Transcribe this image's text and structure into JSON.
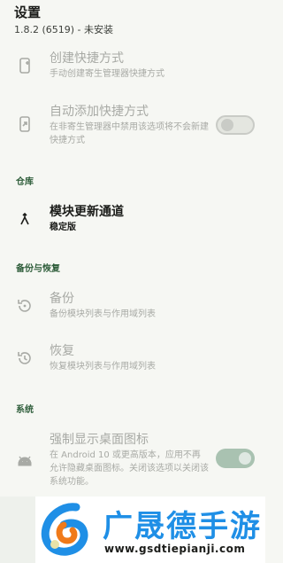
{
  "header": {
    "title": "设置",
    "subtitle": "1.8.2 (6519) - 未安装"
  },
  "shortcuts": {
    "create": {
      "title": "创建快捷方式",
      "summary": "手动创建寄生管理器快捷方式"
    },
    "auto_add": {
      "title": "自动添加快捷方式",
      "summary": "在非寄生管理器中禁用该选项将不会新建快捷方式",
      "switch_on": false
    }
  },
  "repo": {
    "section": "仓库",
    "channel": {
      "title": "模块更新通道",
      "summary": "稳定版"
    }
  },
  "backup": {
    "section": "备份与恢复",
    "backup_item": {
      "title": "备份",
      "summary": "备份模块列表与作用域列表"
    },
    "restore_item": {
      "title": "恢复",
      "summary": "恢复模块列表与作用域列表"
    }
  },
  "system": {
    "section": "系统",
    "desktop_icon": {
      "title": "强制显示桌面图标",
      "summary": "在 Android 10 或更高版本，应用不再允许隐藏桌面图标。关闭该选项以关闭该系统功能。",
      "switch_on": true
    }
  },
  "watermark": {
    "brand": "广晟德手游",
    "url": "www.gsdtiepianji.com"
  },
  "colors": {
    "section": "#2e5d3a",
    "brand": "#1f8fe6",
    "switch_on": "#a9c2b1"
  }
}
